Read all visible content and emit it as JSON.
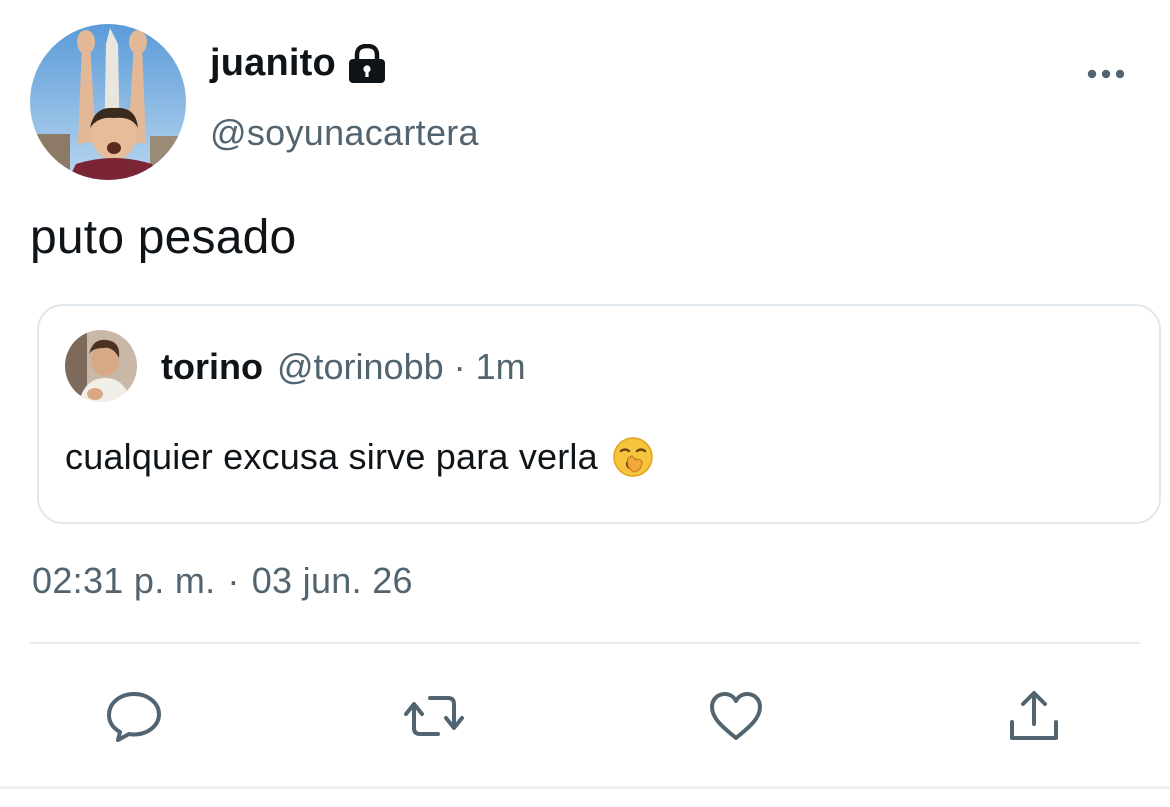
{
  "tweet": {
    "author": {
      "display_name": "juanito",
      "handle": "@soyunacartera",
      "protected_icon": "lock-icon",
      "avatar": "avatar-photo"
    },
    "text": "puto pesado",
    "quoted": {
      "display_name": "torino",
      "handle": "@torinobb",
      "separator": "·",
      "time_ago": "1m",
      "text": "cualquier excusa sirve para verla",
      "emoji": "yawning-face-emoji"
    },
    "time": "02:31 p. m.",
    "separator": "·",
    "date": "03 jun. 26"
  },
  "actions": [
    {
      "name": "reply",
      "icon": "reply-icon"
    },
    {
      "name": "retweet",
      "icon": "retweet-icon"
    },
    {
      "name": "like",
      "icon": "heart-icon"
    },
    {
      "name": "share",
      "icon": "share-icon"
    }
  ],
  "colors": {
    "text_primary": "#0f1419",
    "text_secondary": "#536471",
    "border": "#e1e8ed",
    "background": "#ffffff"
  }
}
